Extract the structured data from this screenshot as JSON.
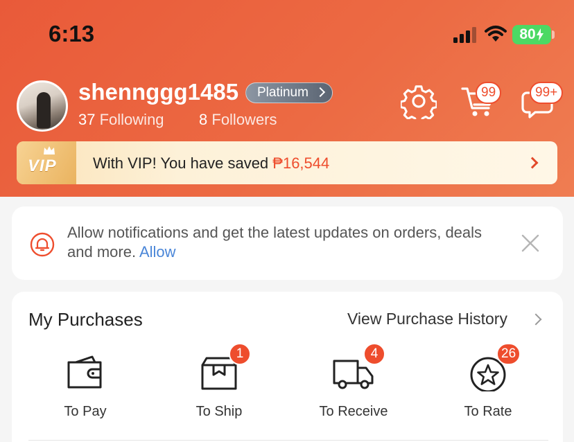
{
  "status_bar": {
    "time": "6:13",
    "battery": "80"
  },
  "profile": {
    "username": "shennggg1485",
    "tier": "Platinum",
    "following_count": "37",
    "following_label": "Following",
    "followers_count": "8",
    "followers_label": "Followers"
  },
  "header_icons": {
    "settings": "gear-icon",
    "cart": "cart-icon",
    "cart_badge": "99",
    "chat": "chat-icon",
    "chat_badge": "99+"
  },
  "vip": {
    "logo": "VIP",
    "message": "With VIP! You have saved ",
    "amount": "₱16,544"
  },
  "notification": {
    "text": "Allow notifications and get the latest updates on orders, deals and more. ",
    "link": "Allow"
  },
  "purchases": {
    "title": "My Purchases",
    "history_link": "View Purchase History",
    "items": [
      {
        "label": "To Pay",
        "icon": "wallet-icon",
        "badge": ""
      },
      {
        "label": "To Ship",
        "icon": "box-icon",
        "badge": "1"
      },
      {
        "label": "To Receive",
        "icon": "truck-icon",
        "badge": "4"
      },
      {
        "label": "To Rate",
        "icon": "star-icon",
        "badge": "26"
      }
    ]
  },
  "colors": {
    "brand": "#ee4d2d",
    "link": "#4a86d8",
    "battery": "#4cd964"
  }
}
